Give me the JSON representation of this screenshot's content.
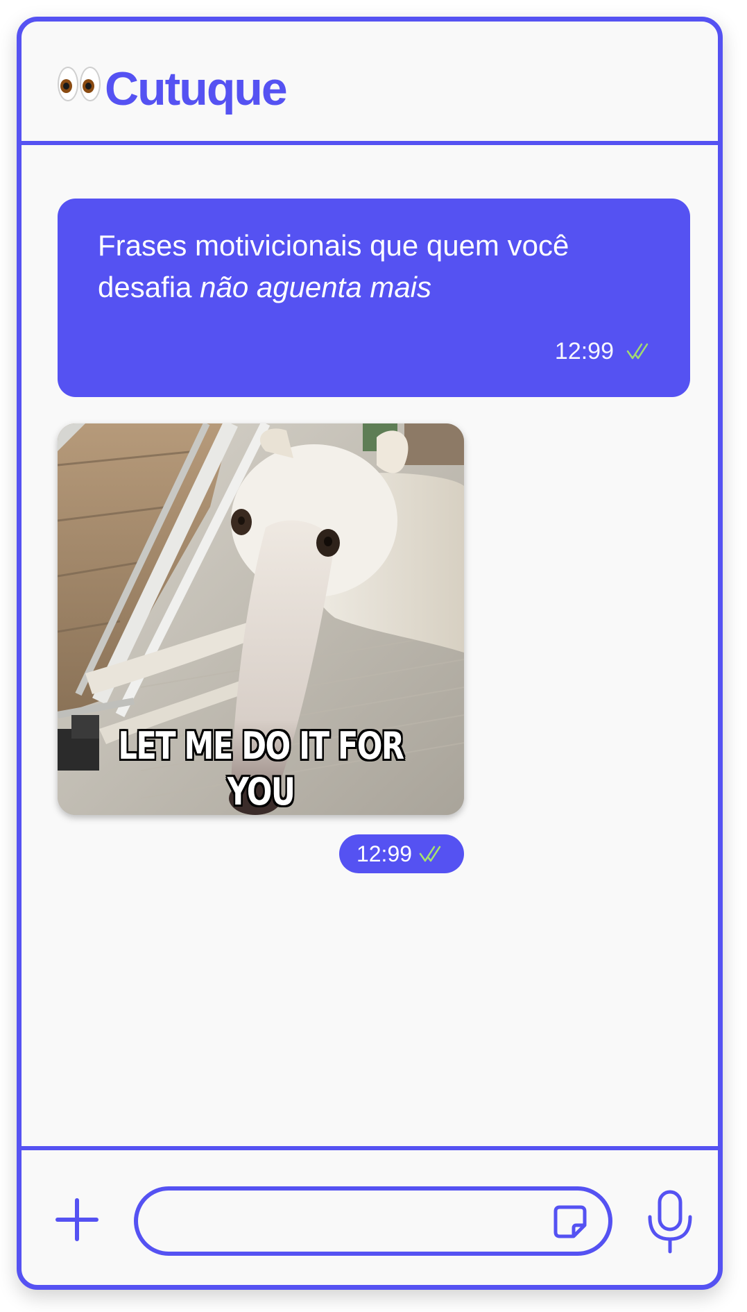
{
  "header": {
    "logo_icon": "eyes-emoji-icon",
    "app_name": "Cutuque"
  },
  "messages": [
    {
      "type": "text",
      "text_plain": "Frases motivicionais que quem você desafia",
      "text_italic": "não aguenta mais",
      "time": "12:99",
      "status_icon": "double-check-icon"
    },
    {
      "type": "image",
      "image_description_icon": "meme-image",
      "caption": "LET ME DO IT FOR YOU",
      "time": "12:99",
      "status_icon": "double-check-icon"
    }
  ],
  "composer": {
    "attach_icon": "plus-icon",
    "input_value": "",
    "input_placeholder": "",
    "sticker_icon": "sticker-icon",
    "mic_icon": "microphone-icon"
  },
  "colors": {
    "accent": "#5552f2",
    "background": "#f9f9f9",
    "read_check": "#a7e36b"
  }
}
